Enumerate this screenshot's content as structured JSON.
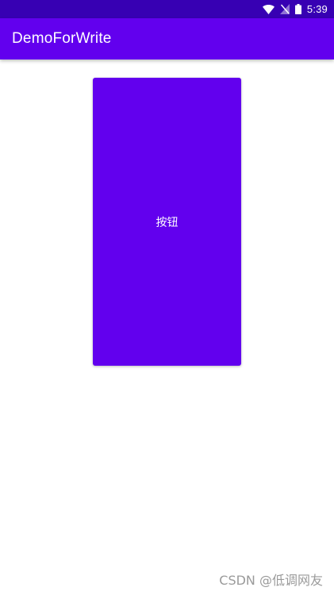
{
  "status_bar": {
    "time": "5:39",
    "icons": [
      "wifi-icon",
      "no-sim-icon",
      "battery-icon"
    ],
    "background_color": "#3700B3"
  },
  "app_bar": {
    "title": "DemoForWrite",
    "background_color": "#6200EE"
  },
  "main": {
    "button_label": "按钮",
    "button_color": "#6200EE"
  },
  "watermark": {
    "text": "CSDN @低调网友"
  }
}
